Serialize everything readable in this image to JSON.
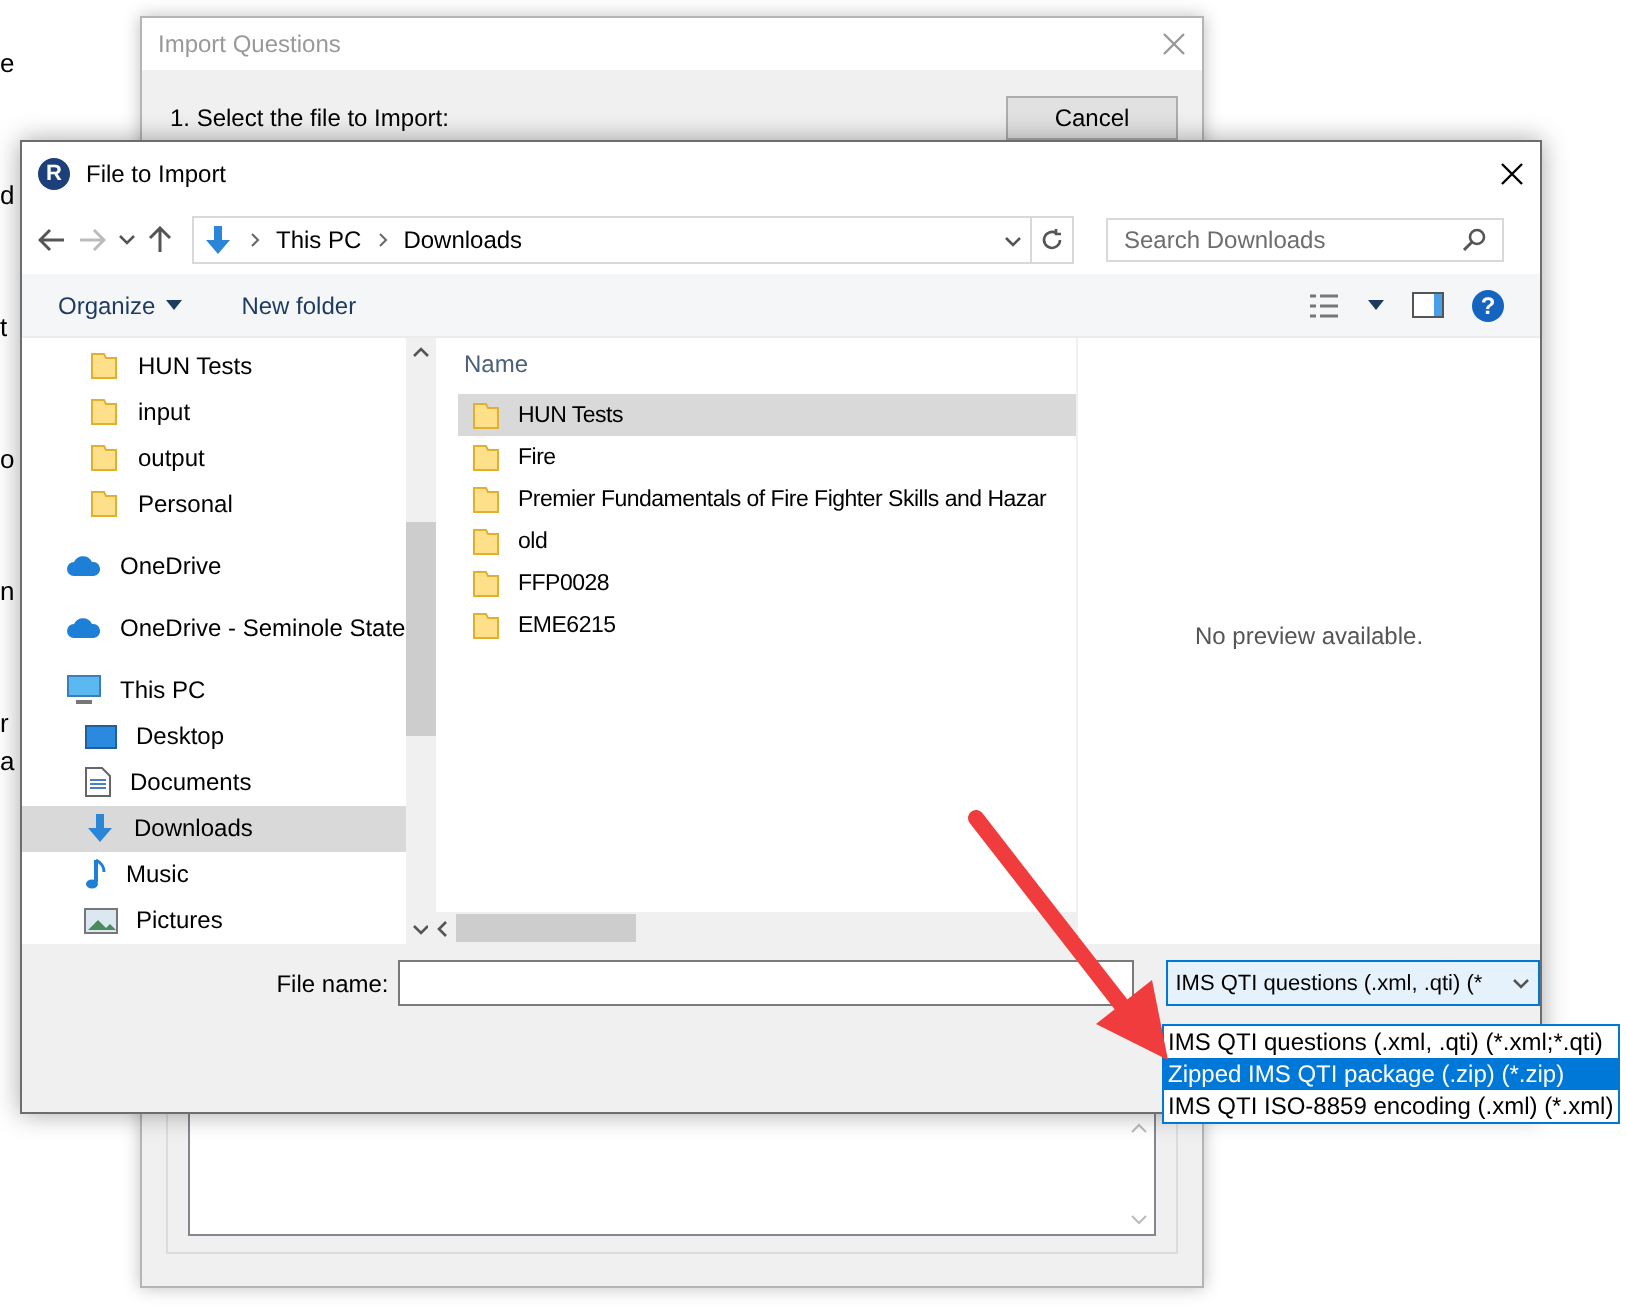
{
  "background_page": {
    "text_fragments": [
      "e",
      "d",
      "t",
      "o",
      "n",
      "r",
      "a"
    ]
  },
  "import_dialog": {
    "title": "Import Questions",
    "step": "1.  Select the file to Import:",
    "cancel_button": "Cancel"
  },
  "file_dialog": {
    "app_icon_letter": "R",
    "title": "File to Import",
    "breadcrumb": [
      "This PC",
      "Downloads"
    ],
    "search": {
      "placeholder": "Search Downloads"
    },
    "toolbar": {
      "organize": "Organize",
      "new_folder": "New folder",
      "help": "?"
    },
    "nav_pane": {
      "items": [
        {
          "label": "HUN Tests",
          "kind": "folder",
          "selected": false
        },
        {
          "label": "input",
          "kind": "folder",
          "selected": false
        },
        {
          "label": "output",
          "kind": "folder",
          "selected": false
        },
        {
          "label": "Personal",
          "kind": "folder",
          "selected": false
        },
        {
          "label": "OneDrive",
          "kind": "cloud",
          "selected": false
        },
        {
          "label": "OneDrive - Seminole State",
          "kind": "cloud",
          "selected": false
        },
        {
          "label": "This PC",
          "kind": "pc",
          "selected": false,
          "children": [
            {
              "label": "Desktop",
              "kind": "desktop",
              "selected": false
            },
            {
              "label": "Documents",
              "kind": "documents",
              "selected": false
            },
            {
              "label": "Downloads",
              "kind": "downloads",
              "selected": true
            },
            {
              "label": "Music",
              "kind": "music",
              "selected": false
            },
            {
              "label": "Pictures",
              "kind": "pictures",
              "selected": false
            }
          ]
        }
      ]
    },
    "file_list": {
      "column": "Name",
      "rows": [
        {
          "name": "HUN Tests",
          "selected": true
        },
        {
          "name": "Fire",
          "selected": false
        },
        {
          "name": "Premier Fundamentals of Fire Fighter Skills and Hazar",
          "selected": false
        },
        {
          "name": "old",
          "selected": false
        },
        {
          "name": "FFP0028",
          "selected": false
        },
        {
          "name": "EME6215",
          "selected": false
        }
      ]
    },
    "preview": "No preview available.",
    "file_name": {
      "label": "File name:"
    },
    "file_type": {
      "value": "IMS QTI questions (.xml, .qti) (*",
      "options": [
        {
          "label": "IMS QTI questions (.xml, .qti) (*.xml;*.qti)",
          "selected": false
        },
        {
          "label": "Zipped IMS QTI package (.zip) (*.zip)",
          "selected": true
        },
        {
          "label": "IMS QTI ISO-8859 encoding (.xml) (*.xml)",
          "selected": false
        }
      ]
    }
  }
}
